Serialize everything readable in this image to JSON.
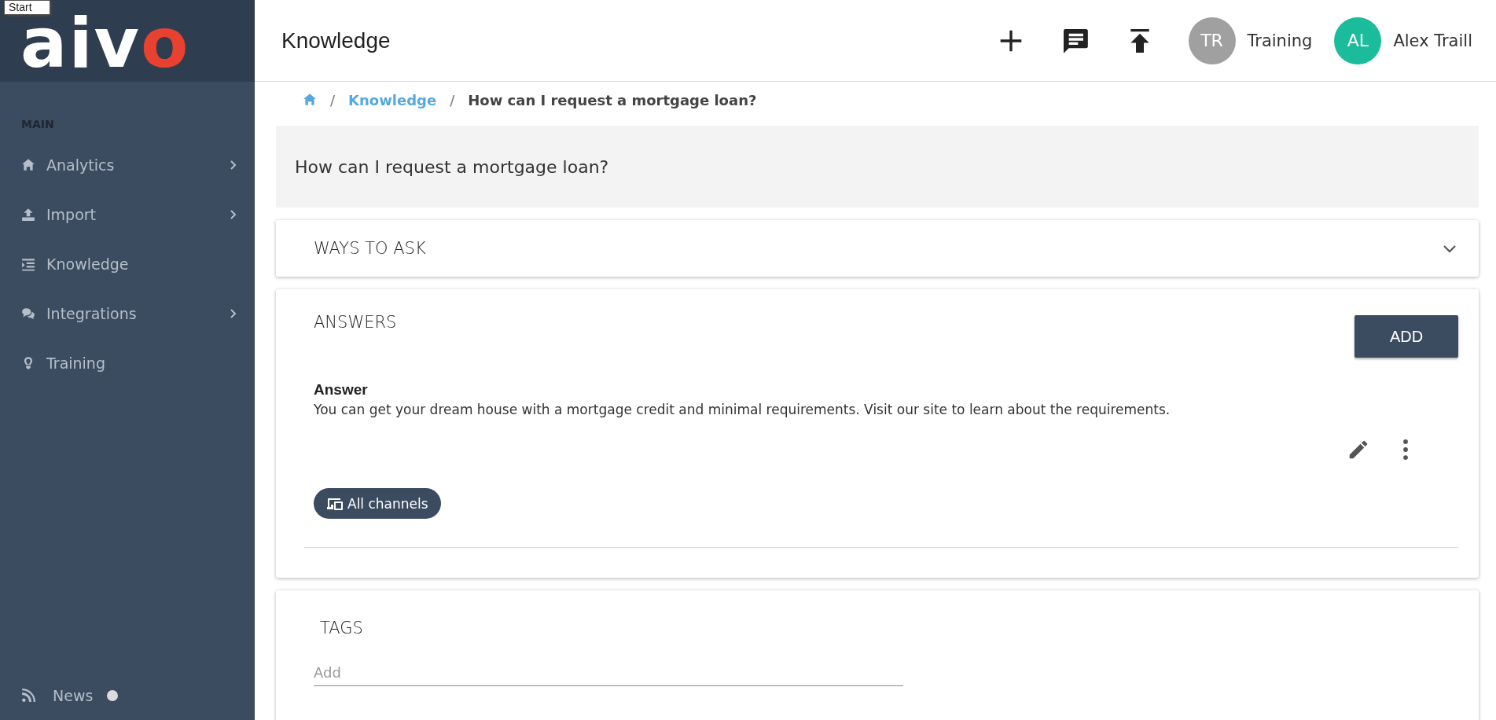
{
  "tooltip": "Start",
  "logo": {
    "main": "aiv",
    "accent": "o"
  },
  "sidebar": {
    "section": "MAIN",
    "items": [
      {
        "label": "Analytics",
        "kind": "home",
        "has_submenu": true
      },
      {
        "label": "Import",
        "kind": "upload",
        "has_submenu": true
      },
      {
        "label": "Knowledge",
        "kind": "list",
        "has_submenu": false
      },
      {
        "label": "Integrations",
        "kind": "chat",
        "has_submenu": true
      },
      {
        "label": "Training",
        "kind": "bulb",
        "has_submenu": false
      }
    ],
    "footer": {
      "label": "News",
      "unread": true
    }
  },
  "header": {
    "title": "Knowledge",
    "users": [
      {
        "initials": "TR",
        "name": "Training",
        "color": "#a0a0a0"
      },
      {
        "initials": "AL",
        "name": "Alex Traill",
        "color": "#1abc9c"
      }
    ]
  },
  "breadcrumb": {
    "separators": [
      "/",
      "/"
    ],
    "link": "Knowledge",
    "current": "How can I request a mortgage loan?"
  },
  "question": "How can I request a mortgage loan?",
  "ways_to_ask": {
    "title": "WAYS TO ASK",
    "expanded": false
  },
  "answers": {
    "title": "ANSWERS",
    "add_button": "ADD",
    "items": [
      {
        "heading": "Answer",
        "text": "You can get your dream house with a mortgage credit and minimal requirements. Visit our site to learn about the requirements.",
        "channel": "All channels"
      }
    ]
  },
  "tags": {
    "title": "TAGS",
    "placeholder": "Add"
  }
}
